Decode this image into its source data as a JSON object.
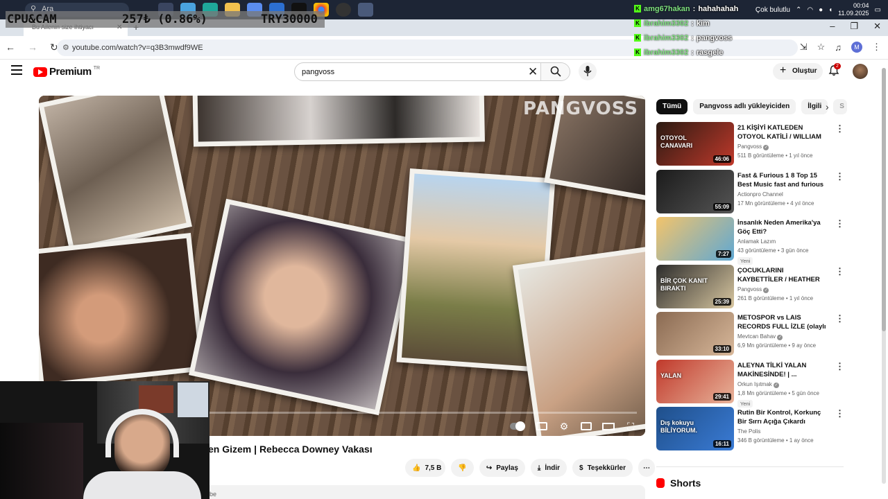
{
  "taskbar": {
    "search_placeholder": "Ara",
    "clock_time": "00:04",
    "clock_date": "11.09.2025",
    "tray_text": "Çok bulutlu"
  },
  "browser": {
    "tab_title": "Bu Ailenin size ihtiyacı",
    "url": "youtube.com/watch?v=q3B3mwdf9WE",
    "profile_initial": "M"
  },
  "youtube": {
    "logo_text": "Premium",
    "logo_region": "TR",
    "search_value": "pangvoss",
    "create_label": "Oluştur",
    "notif_count": "2"
  },
  "video": {
    "watermark": "PANGVOSS",
    "title": "en Gizem | Rebecca Downey Vakası",
    "likes": "7,5 B",
    "share_label": "Paylaş",
    "download_label": "İndir",
    "thanks_label": "Teşekkürler",
    "desc_fragment": "be"
  },
  "chips": [
    "Tümü",
    "Pangvoss adlı yükleyiciden",
    "İlgili",
    "S"
  ],
  "recommendations": [
    {
      "title": "21 KİŞİYİ KATLEDEN OTOYOL KATİLİ / WILLIAM BONIN ...",
      "channel": "Pangvoss",
      "verified": true,
      "meta": "511 B görüntüleme • 1 yıl önce",
      "duration": "46:06",
      "badge": "",
      "thumb_text": "OTOYOL CANAVARI",
      "colors": [
        "#2a1a12",
        "#c0392b"
      ]
    },
    {
      "title": "Fast & Furious 1 8 Top 15 Best Music fast and furious film ...",
      "channel": "Actionpro Channel",
      "verified": false,
      "meta": "17 Mn görüntüleme • 4 yıl önce",
      "duration": "55:09",
      "badge": "",
      "thumb_text": "",
      "colors": [
        "#1b1b1b",
        "#555555"
      ]
    },
    {
      "title": "İnsanlık Neden Amerika'ya Göç Etti?",
      "channel": "Anlamak Lazım",
      "verified": false,
      "meta": "43 görüntüleme • 3 gün önce",
      "duration": "7:27",
      "badge": "Yeni",
      "thumb_text": "",
      "colors": [
        "#f3c46b",
        "#5fa8d3"
      ]
    },
    {
      "title": "ÇOCUKLARINI KAYBETTİLER / HEATHER MAPLES VAKASI / ...",
      "channel": "Pangvoss",
      "verified": true,
      "meta": "261 B görüntüleme • 1 yıl önce",
      "duration": "25:39",
      "badge": "",
      "thumb_text": "BİR ÇOK KANIT BIRAKTI",
      "colors": [
        "#2b2b2b",
        "#d9c7a0"
      ]
    },
    {
      "title": "METOSPOR vs LAIS RECORDS FULL İZLE (olaylı maç)",
      "channel": "Mevtcan Bahav",
      "verified": true,
      "meta": "6,9 Mn görüntüleme • 9 ay önce",
      "duration": "33:10",
      "badge": "",
      "thumb_text": "",
      "colors": [
        "#8a6a52",
        "#d8b89a"
      ]
    },
    {
      "title": "ALEYNA TİLKİ YALAN MAKİNESİNDE! | ...",
      "channel": "Orkun Işıtmak",
      "verified": true,
      "meta": "1,8 Mn görüntüleme • 5 gün önce",
      "duration": "29:41",
      "badge": "Yeni",
      "thumb_text": "YALAN",
      "colors": [
        "#c0392b",
        "#e8b39a"
      ]
    },
    {
      "title": "Rutin Bir Kontrol, Korkunç Bir Sırrı Açığa Çıkardı",
      "channel": "The Polis",
      "verified": false,
      "meta": "346 B görüntüleme • 1 ay önce",
      "duration": "16:11",
      "badge": "",
      "thumb_text": "Dış kokuyu BİLİYORUM.",
      "colors": [
        "#1f4f8a",
        "#3a7bd5"
      ]
    }
  ],
  "shorts_label": "Shorts",
  "overlay": {
    "cpu_label": "CPU&CAM",
    "stat_value": "257₺ (0.86%)",
    "goal": "TRY30000",
    "chat": [
      {
        "user": "amg67hakan",
        "message": "hahahahah"
      },
      {
        "user": "ibrahim3302",
        "message": "kim"
      },
      {
        "user": "ibrahim3302",
        "message": "pangvoss"
      },
      {
        "user": "ibrahim3302",
        "message": "rasgele"
      }
    ]
  },
  "colors": {
    "brand_red": "#ff0000",
    "chat_badge": "#53fc18",
    "overlay_bg": "#787878"
  }
}
